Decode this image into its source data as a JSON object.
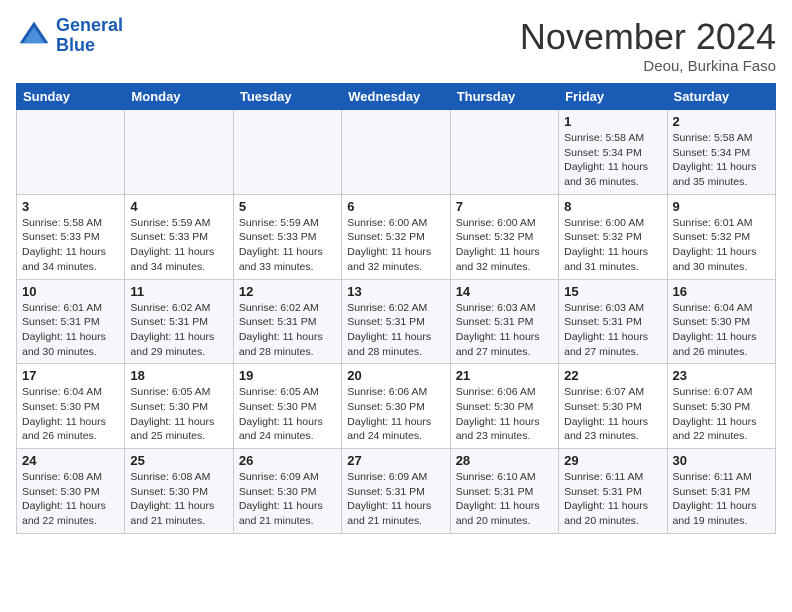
{
  "header": {
    "logo_line1": "General",
    "logo_line2": "Blue",
    "month": "November 2024",
    "location": "Deou, Burkina Faso"
  },
  "weekdays": [
    "Sunday",
    "Monday",
    "Tuesday",
    "Wednesday",
    "Thursday",
    "Friday",
    "Saturday"
  ],
  "weeks": [
    [
      {
        "day": "",
        "info": ""
      },
      {
        "day": "",
        "info": ""
      },
      {
        "day": "",
        "info": ""
      },
      {
        "day": "",
        "info": ""
      },
      {
        "day": "",
        "info": ""
      },
      {
        "day": "1",
        "info": "Sunrise: 5:58 AM\nSunset: 5:34 PM\nDaylight: 11 hours\nand 36 minutes."
      },
      {
        "day": "2",
        "info": "Sunrise: 5:58 AM\nSunset: 5:34 PM\nDaylight: 11 hours\nand 35 minutes."
      }
    ],
    [
      {
        "day": "3",
        "info": "Sunrise: 5:58 AM\nSunset: 5:33 PM\nDaylight: 11 hours\nand 34 minutes."
      },
      {
        "day": "4",
        "info": "Sunrise: 5:59 AM\nSunset: 5:33 PM\nDaylight: 11 hours\nand 34 minutes."
      },
      {
        "day": "5",
        "info": "Sunrise: 5:59 AM\nSunset: 5:33 PM\nDaylight: 11 hours\nand 33 minutes."
      },
      {
        "day": "6",
        "info": "Sunrise: 6:00 AM\nSunset: 5:32 PM\nDaylight: 11 hours\nand 32 minutes."
      },
      {
        "day": "7",
        "info": "Sunrise: 6:00 AM\nSunset: 5:32 PM\nDaylight: 11 hours\nand 32 minutes."
      },
      {
        "day": "8",
        "info": "Sunrise: 6:00 AM\nSunset: 5:32 PM\nDaylight: 11 hours\nand 31 minutes."
      },
      {
        "day": "9",
        "info": "Sunrise: 6:01 AM\nSunset: 5:32 PM\nDaylight: 11 hours\nand 30 minutes."
      }
    ],
    [
      {
        "day": "10",
        "info": "Sunrise: 6:01 AM\nSunset: 5:31 PM\nDaylight: 11 hours\nand 30 minutes."
      },
      {
        "day": "11",
        "info": "Sunrise: 6:02 AM\nSunset: 5:31 PM\nDaylight: 11 hours\nand 29 minutes."
      },
      {
        "day": "12",
        "info": "Sunrise: 6:02 AM\nSunset: 5:31 PM\nDaylight: 11 hours\nand 28 minutes."
      },
      {
        "day": "13",
        "info": "Sunrise: 6:02 AM\nSunset: 5:31 PM\nDaylight: 11 hours\nand 28 minutes."
      },
      {
        "day": "14",
        "info": "Sunrise: 6:03 AM\nSunset: 5:31 PM\nDaylight: 11 hours\nand 27 minutes."
      },
      {
        "day": "15",
        "info": "Sunrise: 6:03 AM\nSunset: 5:31 PM\nDaylight: 11 hours\nand 27 minutes."
      },
      {
        "day": "16",
        "info": "Sunrise: 6:04 AM\nSunset: 5:30 PM\nDaylight: 11 hours\nand 26 minutes."
      }
    ],
    [
      {
        "day": "17",
        "info": "Sunrise: 6:04 AM\nSunset: 5:30 PM\nDaylight: 11 hours\nand 26 minutes."
      },
      {
        "day": "18",
        "info": "Sunrise: 6:05 AM\nSunset: 5:30 PM\nDaylight: 11 hours\nand 25 minutes."
      },
      {
        "day": "19",
        "info": "Sunrise: 6:05 AM\nSunset: 5:30 PM\nDaylight: 11 hours\nand 24 minutes."
      },
      {
        "day": "20",
        "info": "Sunrise: 6:06 AM\nSunset: 5:30 PM\nDaylight: 11 hours\nand 24 minutes."
      },
      {
        "day": "21",
        "info": "Sunrise: 6:06 AM\nSunset: 5:30 PM\nDaylight: 11 hours\nand 23 minutes."
      },
      {
        "day": "22",
        "info": "Sunrise: 6:07 AM\nSunset: 5:30 PM\nDaylight: 11 hours\nand 23 minutes."
      },
      {
        "day": "23",
        "info": "Sunrise: 6:07 AM\nSunset: 5:30 PM\nDaylight: 11 hours\nand 22 minutes."
      }
    ],
    [
      {
        "day": "24",
        "info": "Sunrise: 6:08 AM\nSunset: 5:30 PM\nDaylight: 11 hours\nand 22 minutes."
      },
      {
        "day": "25",
        "info": "Sunrise: 6:08 AM\nSunset: 5:30 PM\nDaylight: 11 hours\nand 21 minutes."
      },
      {
        "day": "26",
        "info": "Sunrise: 6:09 AM\nSunset: 5:30 PM\nDaylight: 11 hours\nand 21 minutes."
      },
      {
        "day": "27",
        "info": "Sunrise: 6:09 AM\nSunset: 5:31 PM\nDaylight: 11 hours\nand 21 minutes."
      },
      {
        "day": "28",
        "info": "Sunrise: 6:10 AM\nSunset: 5:31 PM\nDaylight: 11 hours\nand 20 minutes."
      },
      {
        "day": "29",
        "info": "Sunrise: 6:11 AM\nSunset: 5:31 PM\nDaylight: 11 hours\nand 20 minutes."
      },
      {
        "day": "30",
        "info": "Sunrise: 6:11 AM\nSunset: 5:31 PM\nDaylight: 11 hours\nand 19 minutes."
      }
    ]
  ]
}
